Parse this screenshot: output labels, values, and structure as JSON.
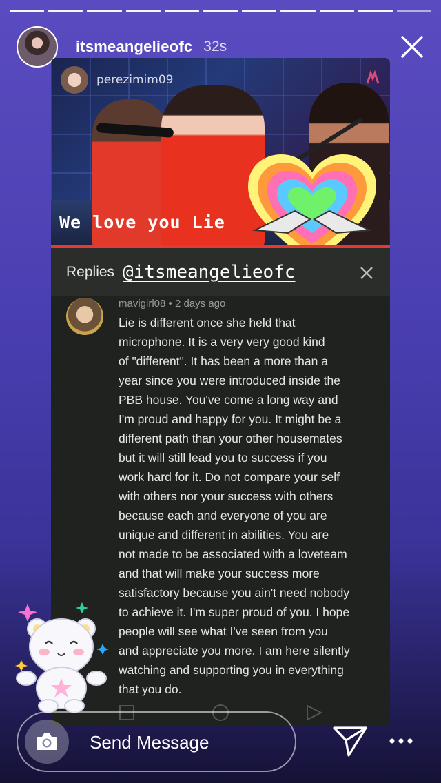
{
  "story": {
    "progress_segments": 11,
    "progress_completed": 10,
    "username": "itsmeangelieofc",
    "time_ago": "32s"
  },
  "video": {
    "overlay_username": "perezimim09",
    "caption": "We love you Lie"
  },
  "replies": {
    "label": "Replies",
    "handle": "@itsmeangelieofc"
  },
  "comment": {
    "author": "mavigirl08",
    "time": "2 days ago",
    "text": "Lie is different once she held that\nmicrophone. It is a very very good kind\nof \"different\". It has been a more than a\nyear since you were introduced inside the\nPBB house. You've come a long way and\nI'm proud and happy for you. It might be a\ndifferent path than your other housemates\nbut it will still lead you to success if you\nwork hard for it. Do not compare your self\nwith others nor your success with others\nbecause each and everyone of you are\nunique and different in abilities. You are\nnot made to be associated with a loveteam\nand that will make your success more\nsatisfactory because you ain't need nobody\nto achieve it. I'm super proud of you. I hope\npeople will see what I've seen from you\nand appreciate you more. I am here silently\nwatching and supporting you in everything\nthat you do."
  },
  "footer": {
    "message_placeholder": "Send Message"
  },
  "icons": {
    "close": "close-icon",
    "camera": "camera-icon",
    "send": "send-icon",
    "more": "more-icon",
    "heart_sticker": "heart-hands-sticker",
    "bear_sticker": "bear-sticker"
  }
}
